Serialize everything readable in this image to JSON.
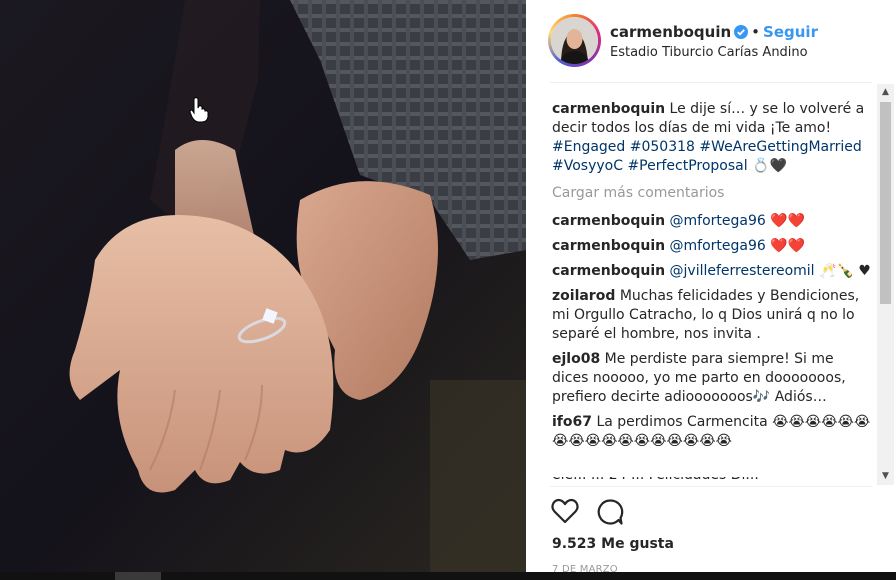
{
  "post": {
    "username": "carmenboquin",
    "follow_label": "Seguir",
    "dot": "•",
    "location": "Estadio Tiburcio Carías Andino",
    "caption": {
      "user": "carmenboquin",
      "text": "Le dije sí… y se lo volveré a decir todos los días de mi vida ¡Te amo!",
      "hashtags": "#Engaged #050318 #WeAreGettingMarried #VosyyoC #PerfectProposal",
      "emoji": "💍🖤"
    },
    "load_more": "Cargar más comentarios",
    "comments": [
      {
        "user": "carmenboquin",
        "mention": "@mfortega96",
        "text": "❤️❤️"
      },
      {
        "user": "carmenboquin",
        "mention": "@mfortega96",
        "text": "❤️❤️"
      },
      {
        "user": "carmenboquin",
        "mention": "@jvilleferrestereomil",
        "text": "🥂🍾 ♥"
      },
      {
        "user": "zoilarod",
        "mention": "",
        "text": "Muchas felicidades y Bendiciones, mi Orgullo Catracho, lo q Dios unirá q no lo separé el hombre, nos invita ."
      },
      {
        "user": "ejlo08",
        "mention": "",
        "text": "Me perdiste para siempre! Si me dices nooooo, yo me parto en dooooooos, prefiero decirte adiooooooos🎶 Adiós…"
      },
      {
        "user": "ifo67",
        "mention": "",
        "text": "La perdimos Carmencita 😭😭😭😭😭😭😭😭😭😭😭😭😭😭😭😭😭"
      }
    ],
    "cut_off_text": "ele... ... 24 ... Felicidades Di...",
    "likes": "9.523 Me gusta",
    "date": "7 DE MARZO"
  },
  "scrollbar": {
    "up": "▲",
    "down": "▼"
  },
  "icons": {
    "verified": "verified-badge-icon",
    "like": "heart-icon",
    "comment": "comment-bubble-icon",
    "cursor": "hand-pointer-icon"
  },
  "colors": {
    "link": "#3897f0",
    "hashtag": "#003569",
    "muted": "#999999",
    "text": "#262626"
  }
}
